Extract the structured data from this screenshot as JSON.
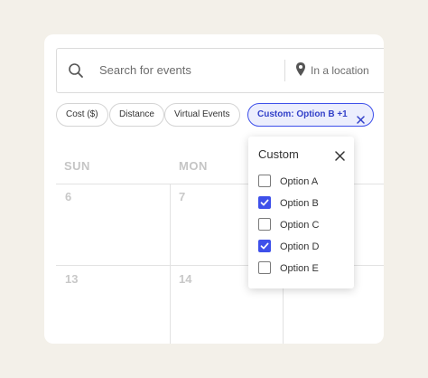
{
  "search": {
    "placeholder": "Search for events",
    "location_placeholder": "In a location"
  },
  "filters": {
    "cost_label": "Cost ($)",
    "distance_label": "Distance",
    "virtual_label": "Virtual Events",
    "custom_label": "Custom: Option B +1"
  },
  "calendar": {
    "days": [
      "SUN",
      "MON"
    ],
    "dates": [
      "6",
      "7",
      "13",
      "14"
    ]
  },
  "dropdown": {
    "title": "Custom",
    "options": [
      {
        "label": "Option A",
        "checked": false
      },
      {
        "label": "Option B",
        "checked": true
      },
      {
        "label": "Option C",
        "checked": false
      },
      {
        "label": "Option D",
        "checked": true
      },
      {
        "label": "Option E",
        "checked": false
      }
    ]
  },
  "colors": {
    "accent": "#3e50ea",
    "background": "#f3f0e9"
  },
  "icons": {
    "search": "search-icon",
    "location": "map-pin-icon",
    "close": "close-icon",
    "check": "checkmark-icon"
  }
}
